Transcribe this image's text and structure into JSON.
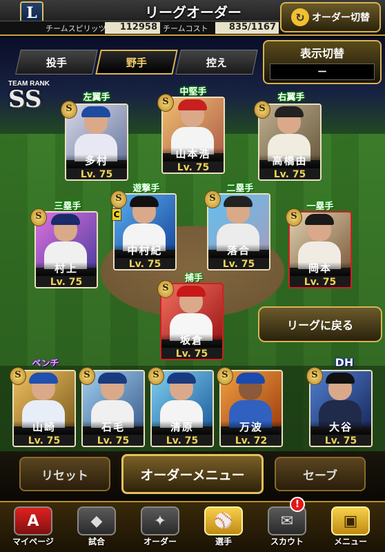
{
  "header": {
    "logo_letter": "L",
    "title": "リーグオーダー",
    "team_spirit_label": "チームスピリッツ",
    "team_spirit_value": "112958",
    "team_cost_label": "チームコスト",
    "team_cost_value": "835/1167",
    "order_switch_label": "オーダー切替",
    "switch_icon": "cycle-arrows-icon"
  },
  "tabs": [
    {
      "label": "投手"
    },
    {
      "label": "野手"
    },
    {
      "label": "控え"
    }
  ],
  "display_toggle": {
    "label": "表示切替",
    "value": "－"
  },
  "team_rank": {
    "label": "TEAM RANK",
    "value": "SS"
  },
  "positions": {
    "lf": "左翼手",
    "cf": "中堅手",
    "rf": "右翼手",
    "ss": "遊撃手",
    "b2": "二塁手",
    "b3": "三塁手",
    "b1": "一塁手",
    "c": "捕手",
    "bench": "ベンチ",
    "dh": "DH"
  },
  "players": {
    "lf": {
      "name": "多村",
      "level": "Lv. 75"
    },
    "cf": {
      "name": "山本浩",
      "level": "Lv. 75"
    },
    "rf": {
      "name": "高橋由",
      "level": "Lv. 75"
    },
    "ss": {
      "name": "中村紀",
      "level": "Lv. 75"
    },
    "b2": {
      "name": "落合",
      "level": "Lv. 75"
    },
    "b3": {
      "name": "村上",
      "level": "Lv. 75"
    },
    "b1": {
      "name": "岡本",
      "level": "Lv. 75"
    },
    "c": {
      "name": "坂倉",
      "level": "Lv. 75"
    },
    "bench1": {
      "name": "山崎",
      "level": "Lv. 75"
    },
    "bench2": {
      "name": "石毛",
      "level": "Lv. 75"
    },
    "bench3": {
      "name": "清原",
      "level": "Lv. 75"
    },
    "bench4": {
      "name": "万波",
      "level": "Lv. 72"
    },
    "dh": {
      "name": "大谷",
      "level": "Lv. 75"
    }
  },
  "badges": {
    "s": "S",
    "captain": "C"
  },
  "back_league_label": "リーグに戻る",
  "controls": {
    "reset": "リセット",
    "order_menu": "オーダーメニュー",
    "save": "セーブ"
  },
  "nav": [
    {
      "label": "マイページ",
      "icon": "A"
    },
    {
      "label": "試合",
      "icon": "◆"
    },
    {
      "label": "オーダー",
      "icon": "✦"
    },
    {
      "label": "選手",
      "icon": "⚾"
    },
    {
      "label": "スカウト",
      "icon": "✉"
    },
    {
      "label": "メニュー",
      "icon": "▣"
    }
  ],
  "notification": "!"
}
